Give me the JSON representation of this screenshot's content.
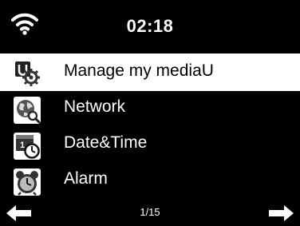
{
  "status": {
    "time": "02:18",
    "wifi_icon": "wifi-icon"
  },
  "menu": {
    "items": [
      {
        "label": "Manage my mediaU",
        "icon": "mediau-gear-icon",
        "selected": true
      },
      {
        "label": "Network",
        "icon": "network-globe-icon",
        "selected": false
      },
      {
        "label": "Date&Time",
        "icon": "calendar-clock-icon",
        "selected": false
      },
      {
        "label": "Alarm",
        "icon": "alarm-clock-icon",
        "selected": false
      }
    ]
  },
  "footer": {
    "page_indicator": "1/15",
    "left_icon": "arrow-left-icon",
    "right_icon": "arrow-right-icon"
  },
  "colors": {
    "background": "#000000",
    "selected_background": "#ffffff",
    "text": "#ffffff",
    "selected_text": "#000000"
  }
}
